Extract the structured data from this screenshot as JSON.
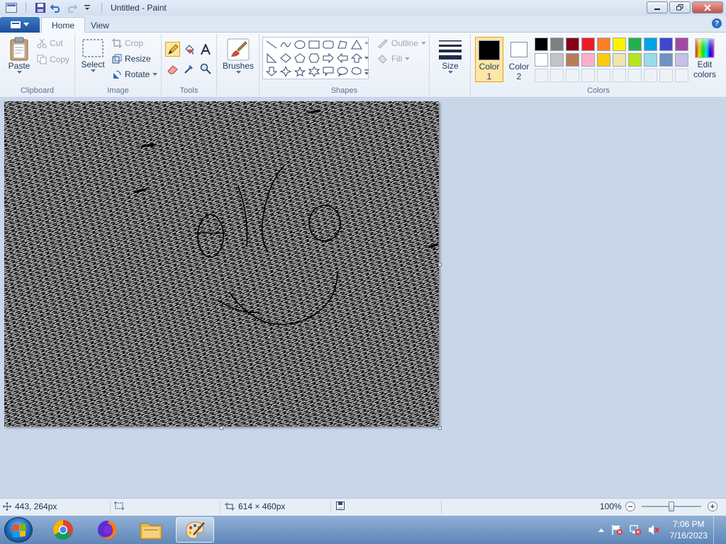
{
  "window": {
    "title": "Untitled - Paint"
  },
  "tabs": [
    {
      "label": "Home",
      "active": true
    },
    {
      "label": "View",
      "active": false
    }
  ],
  "help_glyph": "?",
  "ribbon": {
    "clipboard": {
      "group_label": "Clipboard",
      "paste": "Paste",
      "cut": "Cut",
      "copy": "Copy"
    },
    "image": {
      "group_label": "Image",
      "select": "Select",
      "crop": "Crop",
      "resize": "Resize",
      "rotate": "Rotate"
    },
    "tools": {
      "group_label": "Tools",
      "selected_tool": "pencil"
    },
    "brushes": {
      "label": "Brushes"
    },
    "shapes": {
      "group_label": "Shapes",
      "outline": "Outline",
      "fill": "Fill"
    },
    "size": {
      "label": "Size"
    },
    "colors": {
      "group_label": "Colors",
      "color1_label_line1": "Color",
      "color1_label_line2": "1",
      "color2_label_line1": "Color",
      "color2_label_line2": "2",
      "color1_value": "#000000",
      "color2_value": "#ffffff",
      "edit_line1": "Edit",
      "edit_line2": "colors",
      "palette_row1": [
        "#000000",
        "#7f7f7f",
        "#880015",
        "#ed1c24",
        "#ff7f27",
        "#fff200",
        "#22b14c",
        "#00a2e8",
        "#3f48cc",
        "#a349a4"
      ],
      "palette_row2": [
        "#ffffff",
        "#c3c3c3",
        "#b97a57",
        "#ffaec9",
        "#ffc90e",
        "#efe4b0",
        "#b5e61d",
        "#99d9ea",
        "#7092be",
        "#c8bfe7"
      ]
    }
  },
  "status": {
    "cursor_pos": "443, 264px",
    "selection_size": "",
    "canvas_size": "614 × 460px",
    "zoom": "100%"
  },
  "taskbar": {
    "apps": [
      "Chrome",
      "Firefox",
      "File Explorer",
      "Paint"
    ],
    "time": "7:06 PM",
    "date": "7/16/2023"
  }
}
